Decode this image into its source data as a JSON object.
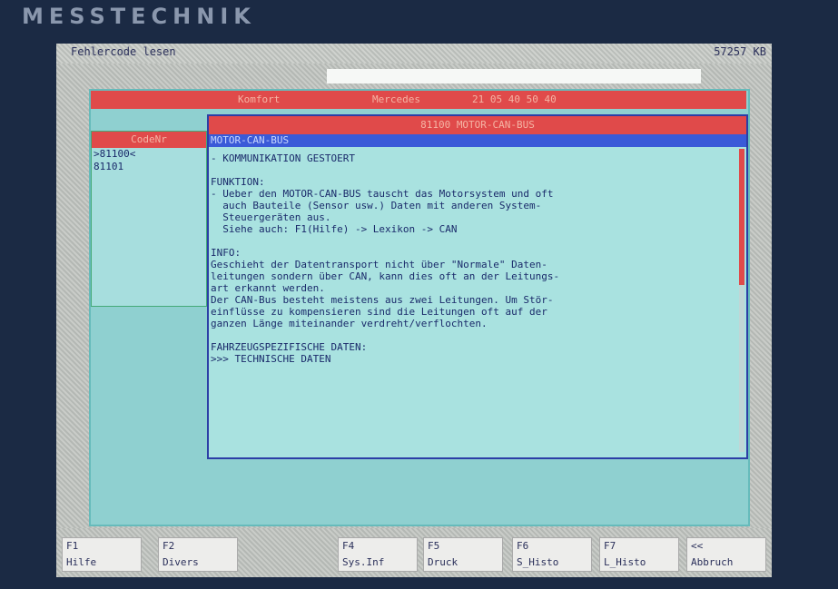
{
  "brand": "MESSTECHNIK",
  "window": {
    "title": "Fehlercode lesen",
    "memory": "57257 KB"
  },
  "header": {
    "item1": "Komfort",
    "item2": "Mercedes",
    "item3": "21 05 40 50 40"
  },
  "codenr": {
    "title": "CodeNr",
    "items": [
      ">81100<",
      "81101"
    ]
  },
  "detail": {
    "title": "81100  MOTOR-CAN-BUS",
    "subtitle": "MOTOR-CAN-BUS",
    "lines": [
      "- KOMMUNIKATION GESTOERT",
      "",
      "FUNKTION:",
      "- Ueber den MOTOR-CAN-BUS tauscht das Motorsystem und oft",
      "  auch Bauteile (Sensor usw.) Daten mit anderen System-",
      "  Steuergeräten aus.",
      "  Siehe auch: F1(Hilfe) -> Lexikon -> CAN",
      "",
      "INFO:",
      "Geschieht der Datentransport nicht über \"Normale\" Daten-",
      "leitungen sondern über CAN, kann dies oft an der Leitungs-",
      "art erkannt werden.",
      "Der CAN-Bus besteht meistens aus zwei Leitungen. Um Stör-",
      "einflüsse zu kompensieren sind die Leitungen oft auf der",
      "ganzen Länge miteinander verdreht/verflochten.",
      "",
      "FAHRZEUGSPEZIFISCHE DATEN:",
      ">>> TECHNISCHE DATEN"
    ]
  },
  "fkeys": [
    {
      "key": "F1",
      "label": "Hilfe"
    },
    {
      "key": "F2",
      "label": "Divers"
    },
    {
      "key": "F4",
      "label": "Sys.Inf"
    },
    {
      "key": "F5",
      "label": "Druck"
    },
    {
      "key": "F6",
      "label": "S_Histo"
    },
    {
      "key": "F7",
      "label": "L_Histo"
    },
    {
      "key": "<<",
      "label": "Abbruch"
    }
  ],
  "colors": {
    "red": "#e04a4a",
    "cyan": "#a9e2e0",
    "blue": "#3a5ad8",
    "text": "#1a2a6a"
  }
}
